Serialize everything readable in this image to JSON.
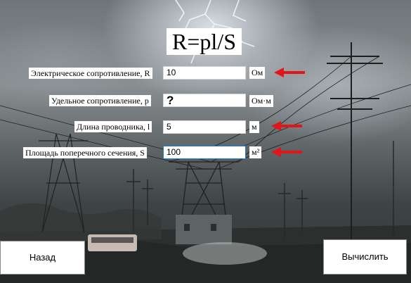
{
  "title": "R=pl/S",
  "fields": [
    {
      "label": "Электрическое сопротивление, R",
      "value": "10",
      "unit": "Ом",
      "arrow": true
    },
    {
      "label": "Удельное сопротивление, p",
      "value": "?",
      "unit": "Ом·м",
      "arrow": false
    },
    {
      "label": "Длина проводника, l",
      "value": "5",
      "unit": "м",
      "arrow": true
    },
    {
      "label": "Площадь поперечного сечения, S",
      "value": "100",
      "unit": "м²",
      "arrow": true
    }
  ],
  "buttons": {
    "back": "Назад",
    "calculate": "Вычислить"
  },
  "colors": {
    "arrow": "#e0161b",
    "focus_border": "#1a7cd3"
  }
}
